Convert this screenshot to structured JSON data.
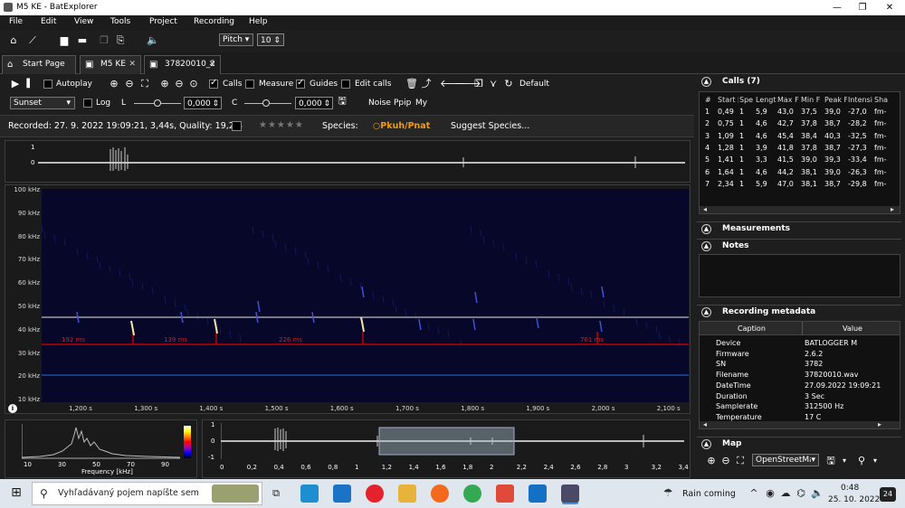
{
  "window": {
    "title": "M5 KE - BatExplorer",
    "minimize": "—",
    "maximize": "❐",
    "close": "✕"
  },
  "menu": [
    "File",
    "Edit",
    "View",
    "Tools",
    "Project",
    "Recording",
    "Help"
  ],
  "toolbar1": {
    "pitch_label": "Pitch",
    "pitch_value": "10"
  },
  "tabs": [
    {
      "label": "Start Page"
    },
    {
      "label": "M5 KE",
      "close": "✕"
    },
    {
      "label": "37820010_2",
      "close": "✕"
    }
  ],
  "spectro_toolbar": {
    "autoplay": "Autoplay",
    "calls": "Calls",
    "measure": "Measure",
    "guides": "Guides",
    "edit_calls": "Edit calls",
    "default": "Default",
    "palette": "Sunset",
    "log": "Log",
    "l_label": "L",
    "l_value": "0,000",
    "c_label": "C",
    "c_value": "0,000",
    "noise": "Noise",
    "ppip": "Ppip",
    "my": "My"
  },
  "info": {
    "recorded": "Recorded: 27. 9. 2022 19:09:21, 3,44s, Quality: 19,2%",
    "stars": "★★★★★",
    "species_label": "Species:",
    "species_value": "Pkuh/Pnat",
    "suggest": "Suggest Species..."
  },
  "wave_top": {
    "y_max": "1",
    "y_zero": "0"
  },
  "spectrogram": {
    "y_ticks": [
      "100 kHz",
      "90 kHz",
      "80 kHz",
      "70 kHz",
      "60 kHz",
      "50 kHz",
      "40 kHz",
      "30 kHz",
      "20 kHz",
      "10 kHz"
    ],
    "x_ticks": [
      "1,200 s",
      "1,300 s",
      "1,400 s",
      "1,500 s",
      "1,600 s",
      "1,700 s",
      "1,800 s",
      "1,900 s",
      "2,000 s",
      "2,100 s"
    ],
    "interval_labels": [
      "192 ms",
      "139 ms",
      "226 ms",
      "701 ms"
    ],
    "info_icon": "i"
  },
  "freq_pane": {
    "x_ticks": [
      "10",
      "30",
      "50",
      "70",
      "90"
    ],
    "xlabel": "Frequency [kHz]"
  },
  "wave_bottom": {
    "y_ticks": [
      "1",
      "0",
      "-1"
    ],
    "x_ticks": [
      "0",
      "0,2",
      "0,4",
      "0,6",
      "0,8",
      "1",
      "1,2",
      "1,4",
      "1,6",
      "1,8",
      "2",
      "2,2",
      "2,4",
      "2,6",
      "2,8",
      "3",
      "3,2",
      "3,4"
    ]
  },
  "calls_panel": {
    "title": "Calls (7)",
    "columns": [
      "#",
      "Start [",
      "Spe",
      "Lengt",
      "Max F",
      "Min F",
      "Peak F",
      "Intensi",
      "Sha"
    ],
    "rows": [
      [
        "1",
        "0,49",
        "1",
        "5,9",
        "43,0",
        "37,5",
        "39,0",
        "-27,0",
        "fm-"
      ],
      [
        "2",
        "0,75",
        "1",
        "4,6",
        "42,7",
        "37,8",
        "38,7",
        "-28,2",
        "fm-"
      ],
      [
        "3",
        "1,09",
        "1",
        "4,6",
        "45,4",
        "38,4",
        "40,3",
        "-32,5",
        "fm-"
      ],
      [
        "4",
        "1,28",
        "1",
        "3,9",
        "41,8",
        "37,8",
        "38,7",
        "-27,3",
        "fm-"
      ],
      [
        "5",
        "1,41",
        "1",
        "3,3",
        "41,5",
        "39,0",
        "39,3",
        "-33,4",
        "fm-"
      ],
      [
        "6",
        "1,64",
        "1",
        "4,6",
        "44,2",
        "38,1",
        "39,0",
        "-26,3",
        "fm-"
      ],
      [
        "7",
        "2,34",
        "1",
        "5,9",
        "47,0",
        "38,1",
        "38,7",
        "-29,8",
        "fm-"
      ]
    ]
  },
  "measurements_panel": {
    "title": "Measurements"
  },
  "notes_panel": {
    "title": "Notes"
  },
  "metadata_panel": {
    "title": "Recording metadata",
    "columns": [
      "Caption",
      "Value"
    ],
    "rows": [
      [
        "Device",
        "BATLOGGER M"
      ],
      [
        "Firmware",
        "2.6.2"
      ],
      [
        "SN",
        "3782"
      ],
      [
        "Filename",
        "37820010.wav"
      ],
      [
        "DateTime",
        "27.09.2022 19:09:21"
      ],
      [
        "Duration",
        "3 Sec"
      ],
      [
        "Samplerate",
        "312500 Hz"
      ],
      [
        "Temperature",
        "17 C"
      ]
    ]
  },
  "map_panel": {
    "title": "Map",
    "provider": "OpenStreetMa"
  },
  "taskbar": {
    "search_placeholder": "Vyhľadávaný pojem napíšte sem",
    "weather": "Rain coming",
    "time": "0:48",
    "date": "25. 10. 2022",
    "notifications": "24"
  },
  "colors": {
    "accent_orange": "#f39c12",
    "spectro_bg": "#07072a",
    "red_line": "#c00000",
    "blue_line": "#2a6fd6"
  }
}
